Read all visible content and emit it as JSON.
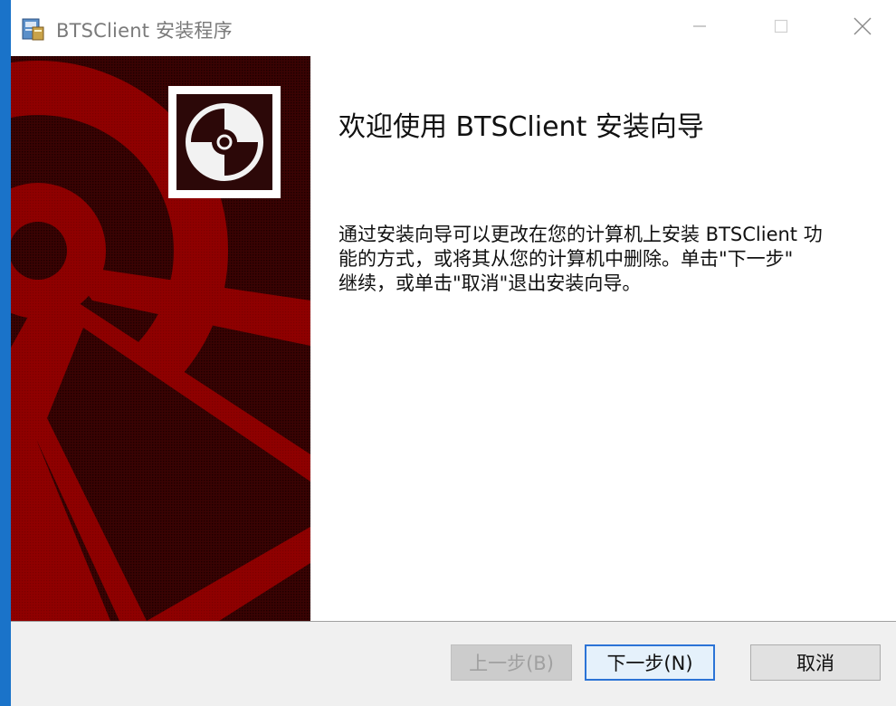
{
  "window": {
    "title": "BTSClient 安装程序",
    "controls": {
      "minimize": "minimize-icon",
      "maximize": "maximize-icon",
      "close": "close-icon"
    }
  },
  "welcome": {
    "heading": "欢迎使用 BTSClient 安装向导",
    "description_lines": [
      "通过安装向导可以更改在您的计算机上安装 BTSClient 功",
      "能的方式，或将其从您的计算机中删除。单击\"下一步\"",
      "继续，或单击\"取消\"退出安装向导。"
    ]
  },
  "buttons": {
    "back": "上一步(B)",
    "next": "下一步(N)",
    "cancel": "取消"
  },
  "colors": {
    "banner_dark": "#2e0000",
    "banner_red": "#8b0000",
    "accent_border": "#1a73c9",
    "default_button_border": "#2b73d6"
  }
}
